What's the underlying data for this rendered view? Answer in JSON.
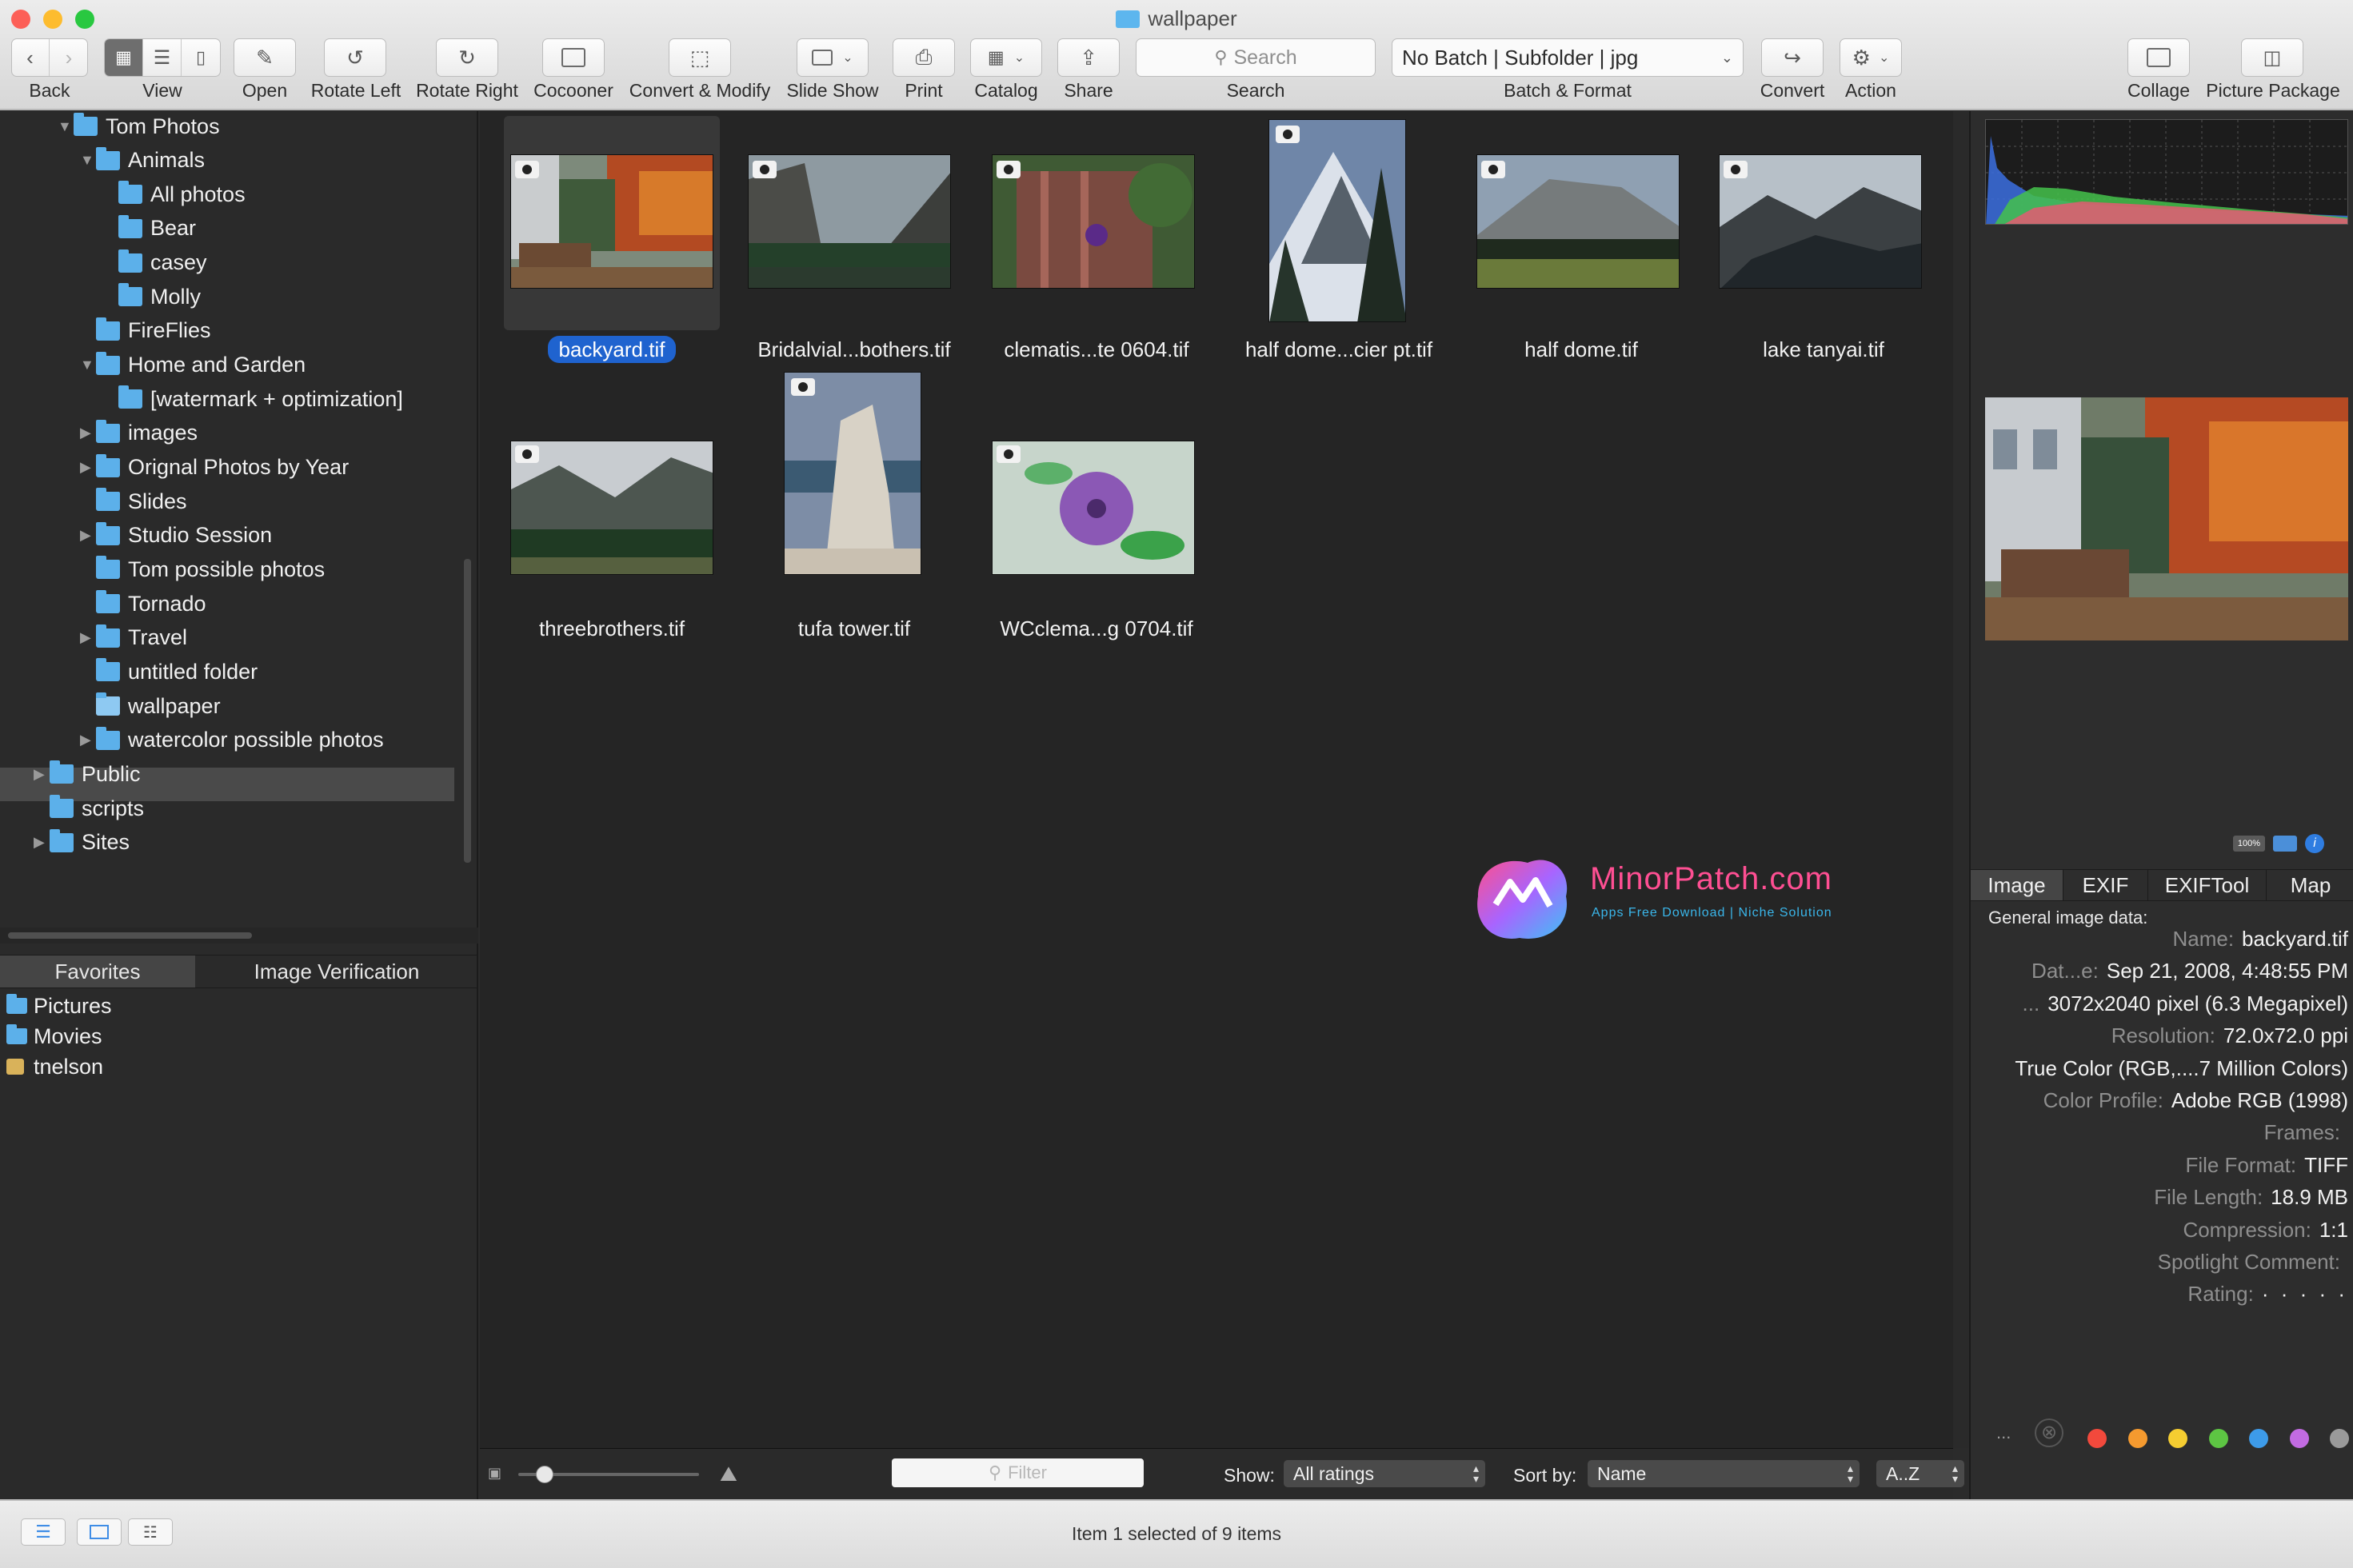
{
  "window": {
    "title": "wallpaper"
  },
  "toolbar": {
    "back": "Back",
    "view": "View",
    "open": "Open",
    "rotate_left": "Rotate Left",
    "rotate_right": "Rotate Right",
    "cocooner": "Cocooner",
    "convert_modify": "Convert & Modify",
    "slide_show": "Slide Show",
    "print": "Print",
    "catalog": "Catalog",
    "share": "Share",
    "search_label": "Search",
    "search_placeholder": "Search",
    "batch_value": "No Batch | Subfolder | jpg",
    "batch_label": "Batch & Format",
    "convert": "Convert",
    "action": "Action",
    "collage": "Collage",
    "picture_package": "Picture Package"
  },
  "sidebar": {
    "tree": [
      {
        "label": "Tom Photos",
        "level": 1,
        "expanded": true
      },
      {
        "label": "Animals",
        "level": 2,
        "expanded": true
      },
      {
        "label": "All photos",
        "level": 3
      },
      {
        "label": "Bear",
        "level": 3
      },
      {
        "label": "casey",
        "level": 3
      },
      {
        "label": "Molly",
        "level": 3
      },
      {
        "label": "FireFlies",
        "level": 2
      },
      {
        "label": "Home and Garden",
        "level": 2,
        "expanded": true
      },
      {
        "label": "[watermark + optimization]",
        "level": 3
      },
      {
        "label": "images",
        "level": 2,
        "collapsed": true
      },
      {
        "label": "Orignal Photos by Year",
        "level": 2,
        "collapsed": true
      },
      {
        "label": "Slides",
        "level": 2
      },
      {
        "label": "Studio Session",
        "level": 2,
        "collapsed": true
      },
      {
        "label": "Tom possible photos",
        "level": 2
      },
      {
        "label": "Tornado",
        "level": 2
      },
      {
        "label": "Travel",
        "level": 2,
        "collapsed": true
      },
      {
        "label": "untitled folder",
        "level": 2
      },
      {
        "label": "wallpaper",
        "level": 2,
        "selected": true
      },
      {
        "label": "watercolor possible photos",
        "level": 2,
        "collapsed": true
      },
      {
        "label": "Public",
        "level": 0,
        "collapsed": true
      },
      {
        "label": "scripts",
        "level": 0
      },
      {
        "label": "Sites",
        "level": 0,
        "collapsed": true
      }
    ],
    "tabs": [
      "Favorites",
      "Image Verification"
    ],
    "favorites": [
      "Pictures",
      "Movies",
      "tnelson"
    ]
  },
  "thumbnails": [
    {
      "caption": "backyard.tif",
      "selected": true
    },
    {
      "caption": "Bridalvial...bothers.tif"
    },
    {
      "caption": "clematis...te 0604.tif"
    },
    {
      "caption": "half dome...cier pt.tif"
    },
    {
      "caption": "half dome.tif"
    },
    {
      "caption": "lake tanyai.tif"
    },
    {
      "caption": "threebrothers.tif"
    },
    {
      "caption": "tufa tower.tif"
    },
    {
      "caption": "WCclema...g 0704.tif"
    }
  ],
  "watermark": {
    "name": "MinorPatch.com",
    "tagline": "Apps Free Download | Niche Solution"
  },
  "bottom_bar": {
    "filter_placeholder": "Filter",
    "show_label": "Show:",
    "show_value": "All ratings",
    "sort_label": "Sort by:",
    "sort_value": "Name",
    "order_value": "A..Z"
  },
  "info_panel": {
    "tabs": [
      "Image",
      "EXIF",
      "EXIFTool",
      "Map"
    ],
    "active_tab": "Image",
    "heading": "General image data:",
    "rows": [
      {
        "key": "Name:",
        "value": "backyard.tif"
      },
      {
        "key": "Dat...e:",
        "value": "Sep 21, 2008, 4:48:55 PM"
      },
      {
        "key": "...",
        "value": "3072x2040 pixel (6.3 Megapixel)"
      },
      {
        "key": "Resolution:",
        "value": "72.0x72.0 ppi"
      },
      {
        "key": "",
        "value": "True Color (RGB,....7 Million Colors)"
      },
      {
        "key": "Color Profile:",
        "value": "Adobe RGB (1998)"
      },
      {
        "key": "Frames:",
        "value": ""
      },
      {
        "key": "File Format:",
        "value": "TIFF"
      },
      {
        "key": "File Length:",
        "value": "18.9 MB"
      },
      {
        "key": "Compression:",
        "value": "1:1"
      },
      {
        "key": "Spotlight Comment:",
        "value": ""
      },
      {
        "key": "Rating:",
        "value": "·  ·  ·  ·  ·"
      }
    ],
    "label_more": "...",
    "label_colors": [
      "#f2493c",
      "#f59a2f",
      "#f5cd31",
      "#5dc543",
      "#3d9be9",
      "#c26be2",
      "#9a9a9a"
    ]
  },
  "status": {
    "text": "Item 1 selected of 9 items"
  }
}
